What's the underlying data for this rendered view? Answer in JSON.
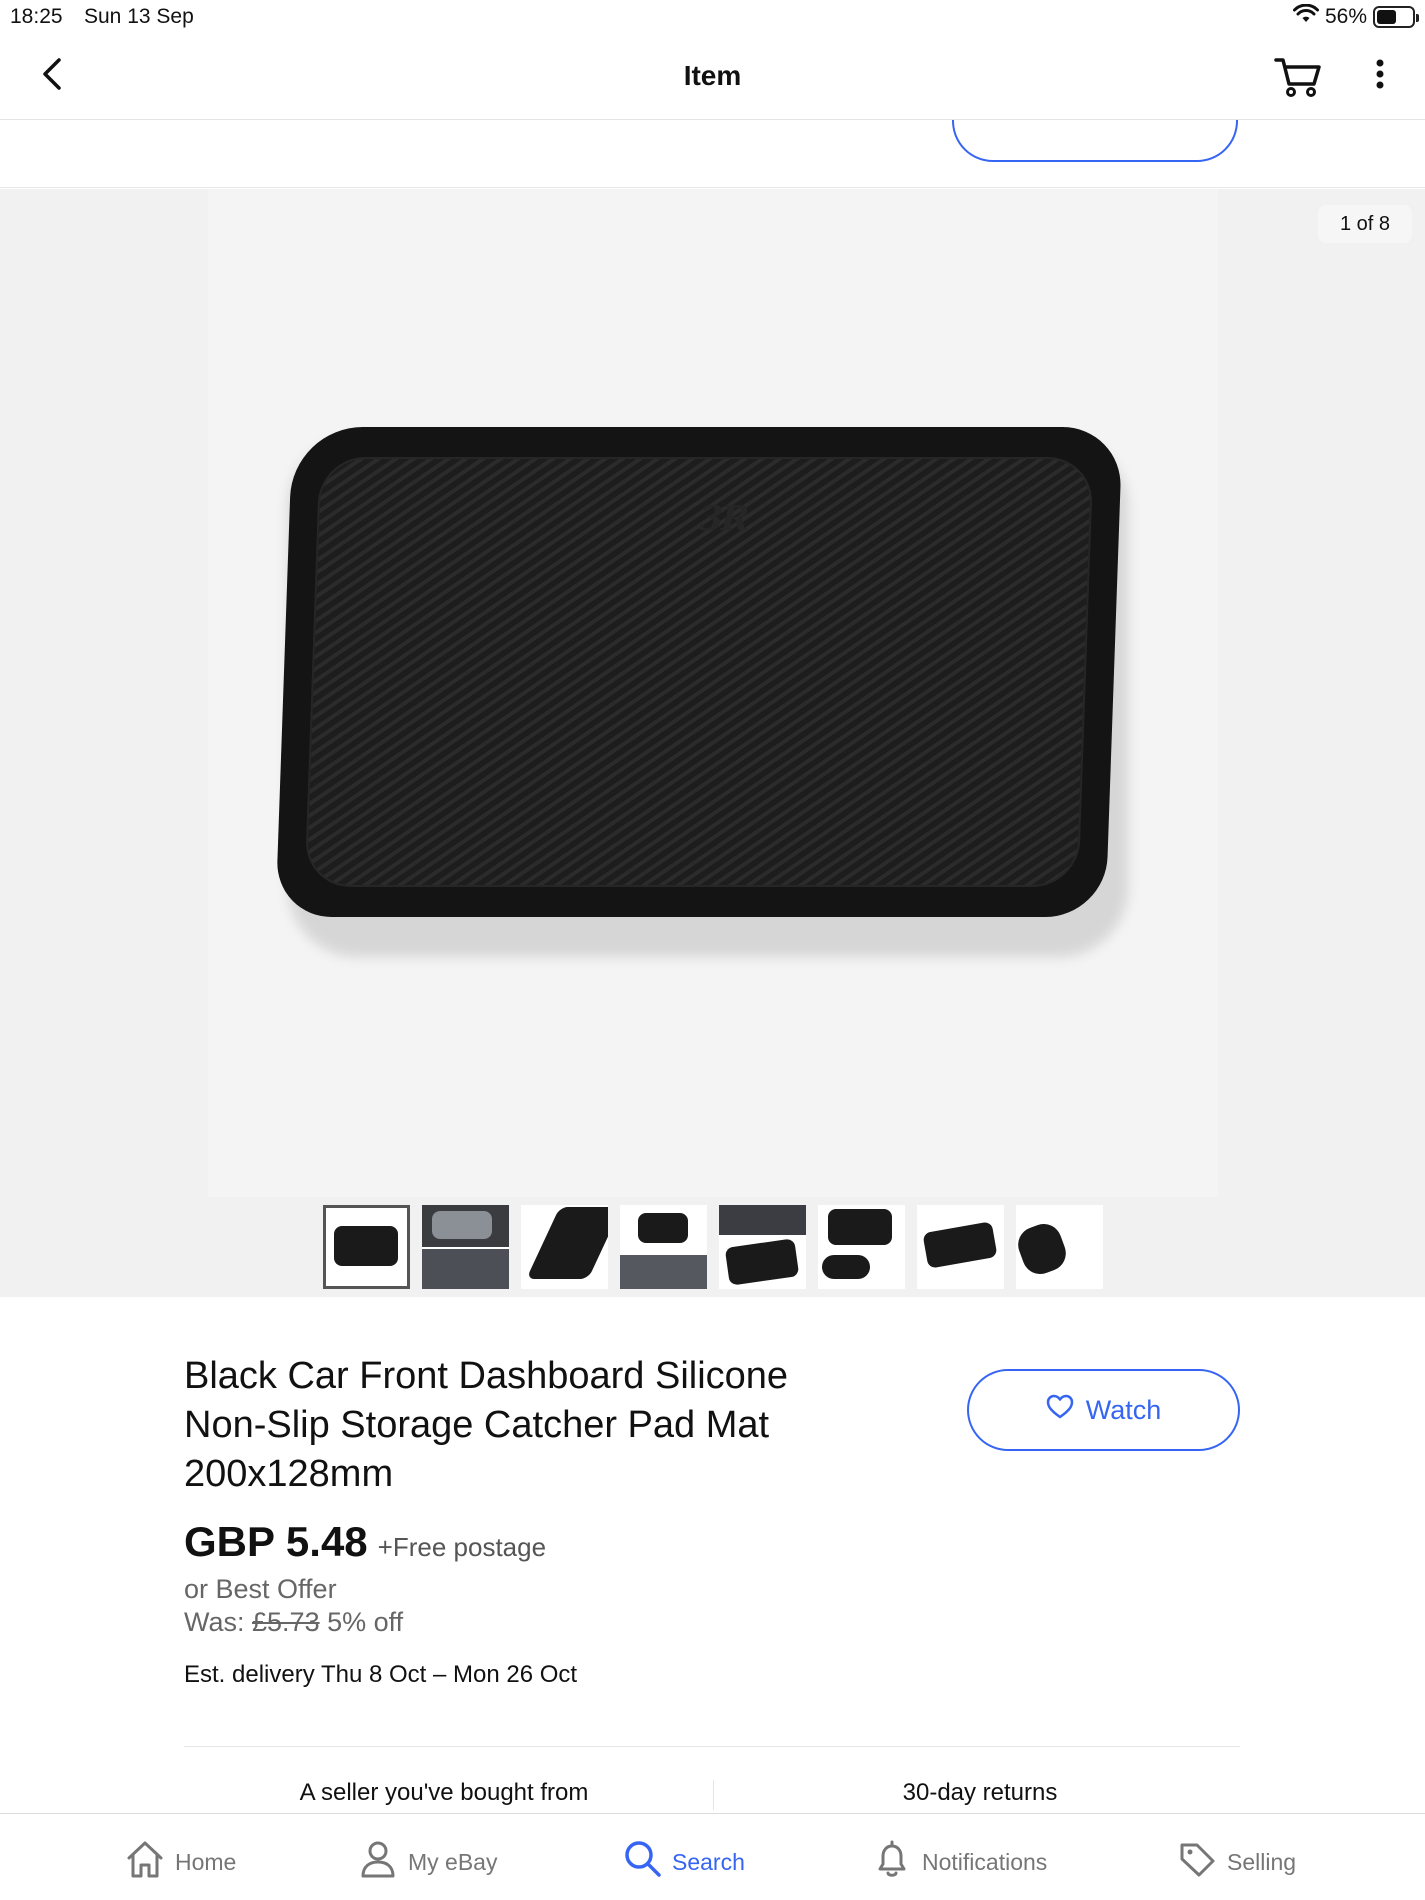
{
  "status_bar": {
    "time": "18:25",
    "date": "Sun 13 Sep",
    "battery": "56%"
  },
  "header": {
    "title": "Item"
  },
  "gallery": {
    "counter": "1 of 8",
    "thumbnail_count": 8,
    "selected_index": 0
  },
  "item": {
    "title": "Black Car Front Dashboard Silicone Non-Slip Storage Catcher Pad Mat 200x128mm",
    "watch_label": "Watch",
    "price": "GBP 5.48",
    "postage": "+Free postage",
    "best_offer": "or Best Offer",
    "was_label": "Was:",
    "was_price": "£5.73",
    "discount": "5% off",
    "delivery_label": "Est. delivery",
    "delivery_dates": "Thu 8 Oct – Mon 26 Oct"
  },
  "features": {
    "left": "A seller you've bought from",
    "right": "30-day returns"
  },
  "bottom_nav": {
    "home": "Home",
    "my_ebay": "My eBay",
    "search": "Search",
    "notifications": "Notifications",
    "selling": "Selling",
    "active": "search",
    "accent_color": "#3665f3"
  }
}
